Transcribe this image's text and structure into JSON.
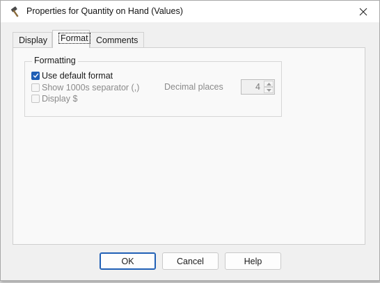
{
  "window": {
    "title": "Properties for Quantity on Hand (Values)",
    "icon": "hammer-icon"
  },
  "tabs": [
    {
      "label": "Display",
      "selected": false
    },
    {
      "label": "Format",
      "selected": true
    },
    {
      "label": "Comments",
      "selected": false
    }
  ],
  "formatting": {
    "group_label": "Formatting",
    "use_default": {
      "label": "Use default format",
      "checked": true,
      "enabled": true
    },
    "thousands_sep": {
      "label": "Show 1000s separator (,)",
      "checked": false,
      "enabled": false
    },
    "display_dollar": {
      "label": "Display $",
      "checked": false,
      "enabled": false
    },
    "decimal_places": {
      "label": "Decimal places",
      "value": "4",
      "enabled": false
    }
  },
  "buttons": {
    "ok": "OK",
    "cancel": "Cancel",
    "help": "Help"
  },
  "colors": {
    "accent": "#1f5fb5",
    "disabled_text": "#8a8a8a"
  }
}
